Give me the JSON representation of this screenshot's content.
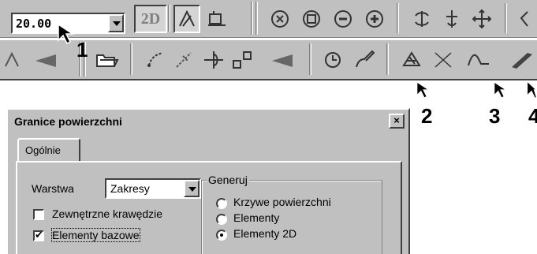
{
  "toolbar1": {
    "value_field": "20.00",
    "button_2d": "2D"
  },
  "toolbar2": {},
  "callouts": [
    "1",
    "2",
    "3",
    "4"
  ],
  "dialog": {
    "title": "Granice powierzchni",
    "close_glyph": "×",
    "tab": "Ogólnie",
    "warstwa_label": "Warstwa",
    "warstwa_value": "Zakresy",
    "checkbox_zewnetrzne": {
      "label": "Zewnętrzne krawędzie",
      "checked": false
    },
    "checkbox_bazowe": {
      "label": "Elementy bazowe",
      "checked": true
    },
    "generuj_label": "Generuj",
    "radio_options": [
      {
        "label": "Krzywe powierzchni",
        "selected": false
      },
      {
        "label": "Elementy",
        "selected": false
      },
      {
        "label": "Elementy 2D",
        "selected": true
      }
    ]
  }
}
